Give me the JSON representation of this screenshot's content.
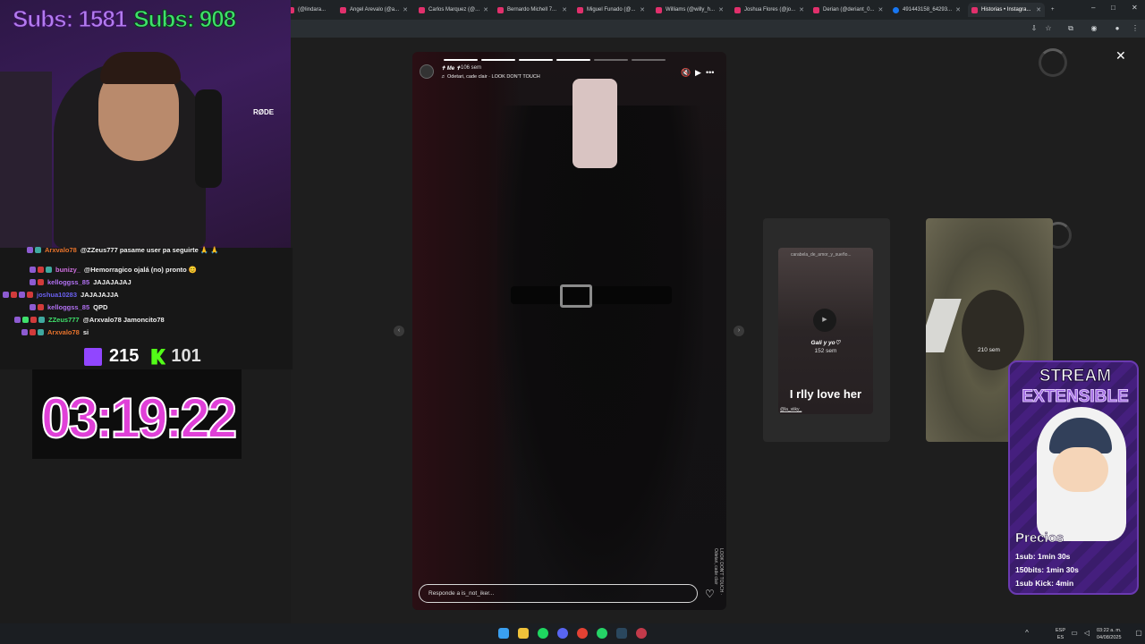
{
  "browser": {
    "tabs": [
      {
        "label": "(@lindara...",
        "icon": "instagram-icon"
      },
      {
        "label": "Angel Arevalo (@a...",
        "icon": "instagram-icon"
      },
      {
        "label": "Carlos Marquez (@...",
        "icon": "instagram-icon"
      },
      {
        "label": "Bernardo Michell 7...",
        "icon": "instagram-icon"
      },
      {
        "label": "Miguel Funado (@...",
        "icon": "instagram-icon"
      },
      {
        "label": "Williams (@willy_h...",
        "icon": "instagram-icon"
      },
      {
        "label": "Joshua Flores (@jo...",
        "icon": "instagram-icon"
      },
      {
        "label": "Derian (@deriant_0...",
        "icon": "instagram-icon"
      },
      {
        "label": "491443158_64293...",
        "icon": "facebook-icon"
      },
      {
        "label": "Historias • Instagra...",
        "icon": "instagram-icon"
      }
    ],
    "new_tab": "+",
    "window_controls": {
      "minimize": "–",
      "maximize": "□",
      "close": "✕"
    }
  },
  "story": {
    "user": "✝ Me ✝",
    "time": "106 sem",
    "song": "♬ Odetari, cade clair · LOOK DON'T TOUCH",
    "reply_placeholder": "Responde a is_not_iker...",
    "side_caption": "LOOK DON'T TOUCH · Odetari, cade clair",
    "progress_segments": 6,
    "progress_done": 3,
    "icons": {
      "mute": "🔇",
      "play": "▶",
      "more": "•••",
      "heart": "♡"
    }
  },
  "viewer": {
    "close_icon": "✕",
    "prev_arrow": "‹",
    "next_arrow": "›"
  },
  "preview_cards": [
    {
      "user": "carabela_de_amor_y_sueño...",
      "caption": "Gali y yo♡",
      "time": "152 sem",
      "text": "I rlly love her",
      "tag": "@la_viiky_"
    },
    {
      "time": "210 sem"
    }
  ],
  "overlay": {
    "subs_1": "Subs: 1581",
    "subs_2": "Subs: 908",
    "mic_brand": "RØDE",
    "chat": [
      {
        "user": "Arxvalo78",
        "color": "#e8732c",
        "msg": "@ZZeus777 pasame user pa seguirte 🙏 🙏"
      },
      {
        "user": "bunizy_",
        "color": "#d070e0",
        "msg": "@Hemorragico ojalá (no) pronto 😊"
      },
      {
        "user": "kelloggss_85",
        "color": "#b070f0",
        "msg": "JAJAJAJAJ"
      },
      {
        "user": "joshua10283",
        "color": "#6a60f0",
        "msg": "JAJAJAJJA"
      },
      {
        "user": "kelloggss_85",
        "color": "#b070f0",
        "msg": "QPD"
      },
      {
        "user": "ZZeus777",
        "color": "#3fe06b",
        "msg": "@Arxvalo78 Jamoncito78"
      },
      {
        "user": "Arxvalo78",
        "color": "#e8732c",
        "msg": "si"
      }
    ],
    "twitch_viewers": "215",
    "kick_viewers": "101",
    "timer": "03:19:22"
  },
  "stream_panel": {
    "title_1": "STREAM",
    "title_2": "EXTENSIBLE",
    "prices_heading": "Precios",
    "prices": [
      "1sub: 1min 30s",
      "150bits: 1min 30s",
      "1sub Kick: 4min"
    ]
  },
  "taskbar": {
    "lang_1": "ESP",
    "lang_2": "ES",
    "time": "03:22 a. m.",
    "date": "04/08/2025"
  }
}
